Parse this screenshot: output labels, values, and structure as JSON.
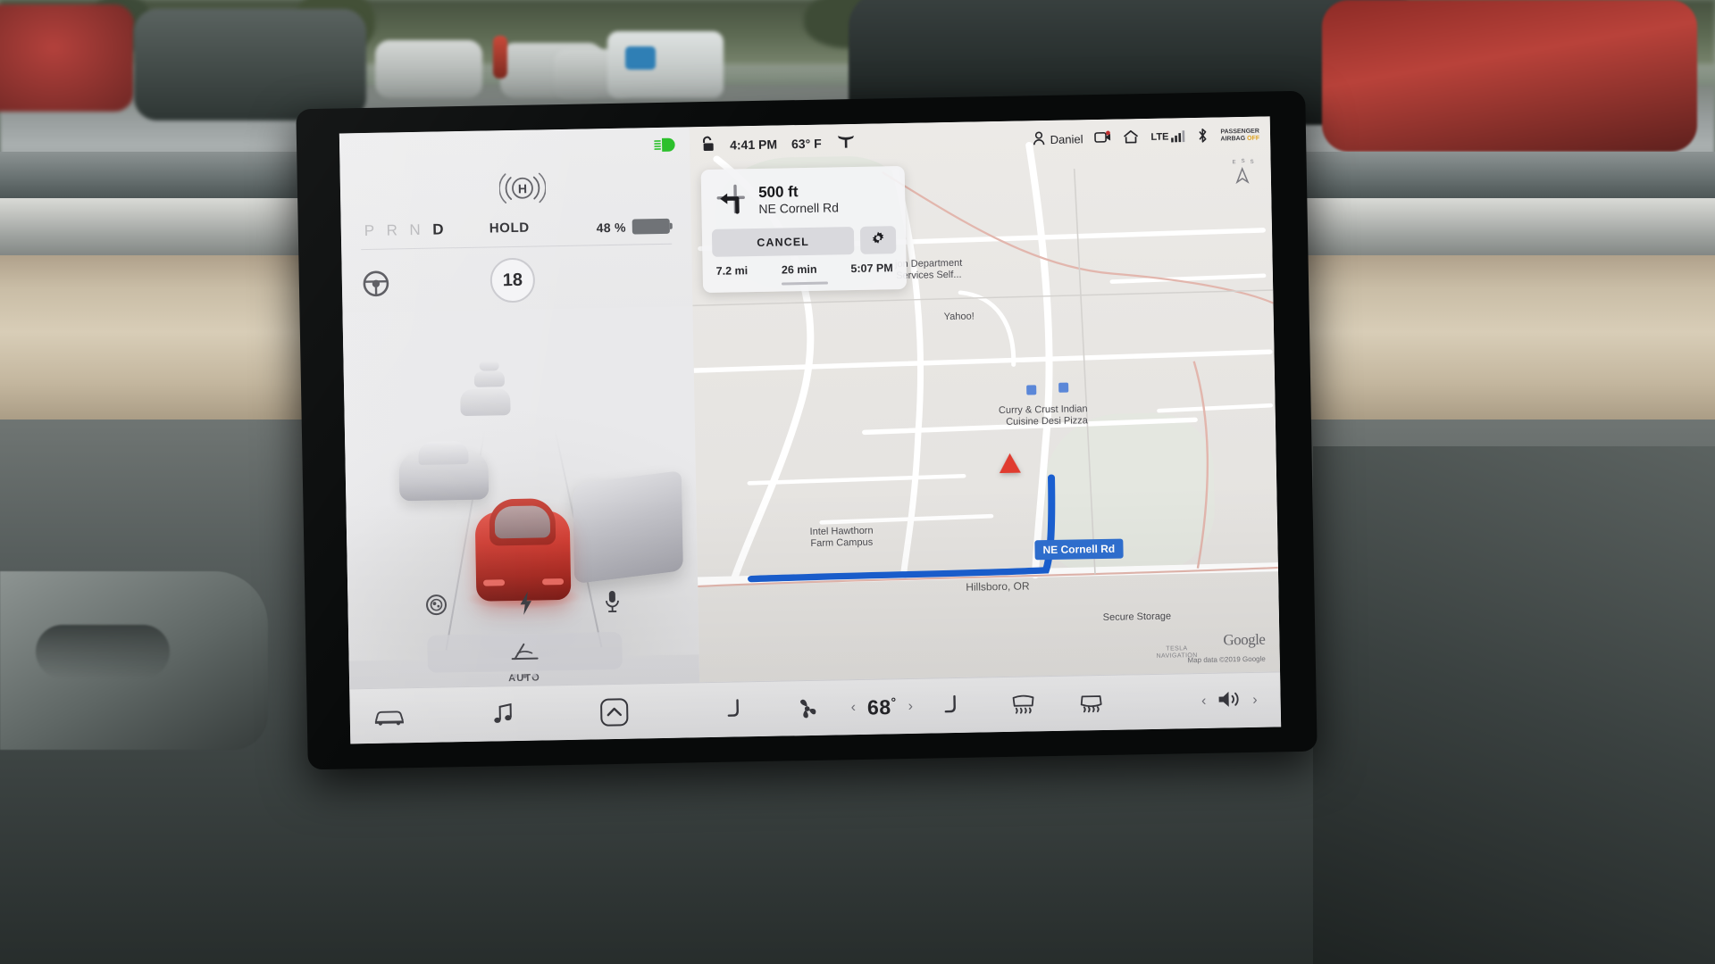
{
  "status_bar": {
    "headlights_icon": "headlight-beam-icon",
    "lock_icon": "unlocked-padlock-icon",
    "time": "4:41 PM",
    "temperature": "63° F",
    "tesla_logo": "tesla-t-icon",
    "profile_name": "Daniel",
    "profile_icon": "person-icon",
    "dashcam_icon": "dashcam-record-icon",
    "home_icon": "home-icon",
    "signal_label": "LTE",
    "signal_icon": "cellular-bars-icon",
    "bluetooth_icon": "bluetooth-icon",
    "airbag_line1": "PASSENGER",
    "airbag_line2": "AIRBAG",
    "airbag_state": "OFF"
  },
  "drive_panel": {
    "gears": [
      "P",
      "R",
      "N",
      "D"
    ],
    "active_gear": "D",
    "hold_label": "HOLD",
    "hold_icon": "hold-brake-icon",
    "battery_percent": "48 %",
    "battery_fill_ratio": 48,
    "battery_color": "#23c723",
    "steering_icon": "steering-wheel-icon",
    "speed_limit": "18",
    "quick_icons": [
      "dashcam-icon",
      "charging-bolt-icon",
      "microphone-icon"
    ],
    "wiper_icon": "wiper-icon",
    "wiper_mode": "AUTO",
    "page_dots": 3,
    "active_dot": 2
  },
  "navigation": {
    "maneuver_icon": "turn-left-icon",
    "distance": "500 ft",
    "street": "NE Cornell Rd",
    "cancel_label": "CANCEL",
    "settings_icon": "gear-icon",
    "trip_distance": "7.2 mi",
    "trip_duration": "26 min",
    "arrival_time": "5:07 PM"
  },
  "map": {
    "compass_icon": "compass-rose-icon",
    "compass_labels": [
      "E",
      "S",
      "S",
      "A"
    ],
    "route_shield": "NE Cornell Rd",
    "city_label": "Hillsboro, OR",
    "provider_logo": "Google",
    "attribution": "Map data ©2019 Google",
    "nav_provider_line1": "TESLA",
    "nav_provider_line2": "NAVIGATION",
    "pois": [
      {
        "name": "jon Department\nServices Self...",
        "pin": "blue"
      },
      {
        "name": "Yahoo!",
        "pin": "blue"
      },
      {
        "name": "Curry & Crust Indian\nCuisine Desi Pizza",
        "pin": "red"
      },
      {
        "name": "Intel Hawthorn\nFarm Campus",
        "pin": "blue"
      },
      {
        "name": "Secure Storage",
        "pin": "red"
      }
    ],
    "route_color": "#1a5fd0",
    "vehicle_marker": "vehicle-heading-arrow"
  },
  "bottom_bar": {
    "car_icon": "car-controls-icon",
    "media_icon": "music-note-icon",
    "expand_icon": "chevron-up-icon",
    "seat_heater_left_icon": "seat-heater-icon",
    "fan_icon": "fan-icon",
    "temp_decrease": "‹",
    "temperature": "68",
    "temperature_unit": "°",
    "temp_increase": "›",
    "seat_heater_right_icon": "seat-heater-icon",
    "rear_defrost_icon": "rear-defrost-icon",
    "front_defrost_icon": "front-defrost-icon",
    "volume_prev": "‹",
    "volume_icon": "speaker-volume-icon",
    "volume_next": "›"
  }
}
